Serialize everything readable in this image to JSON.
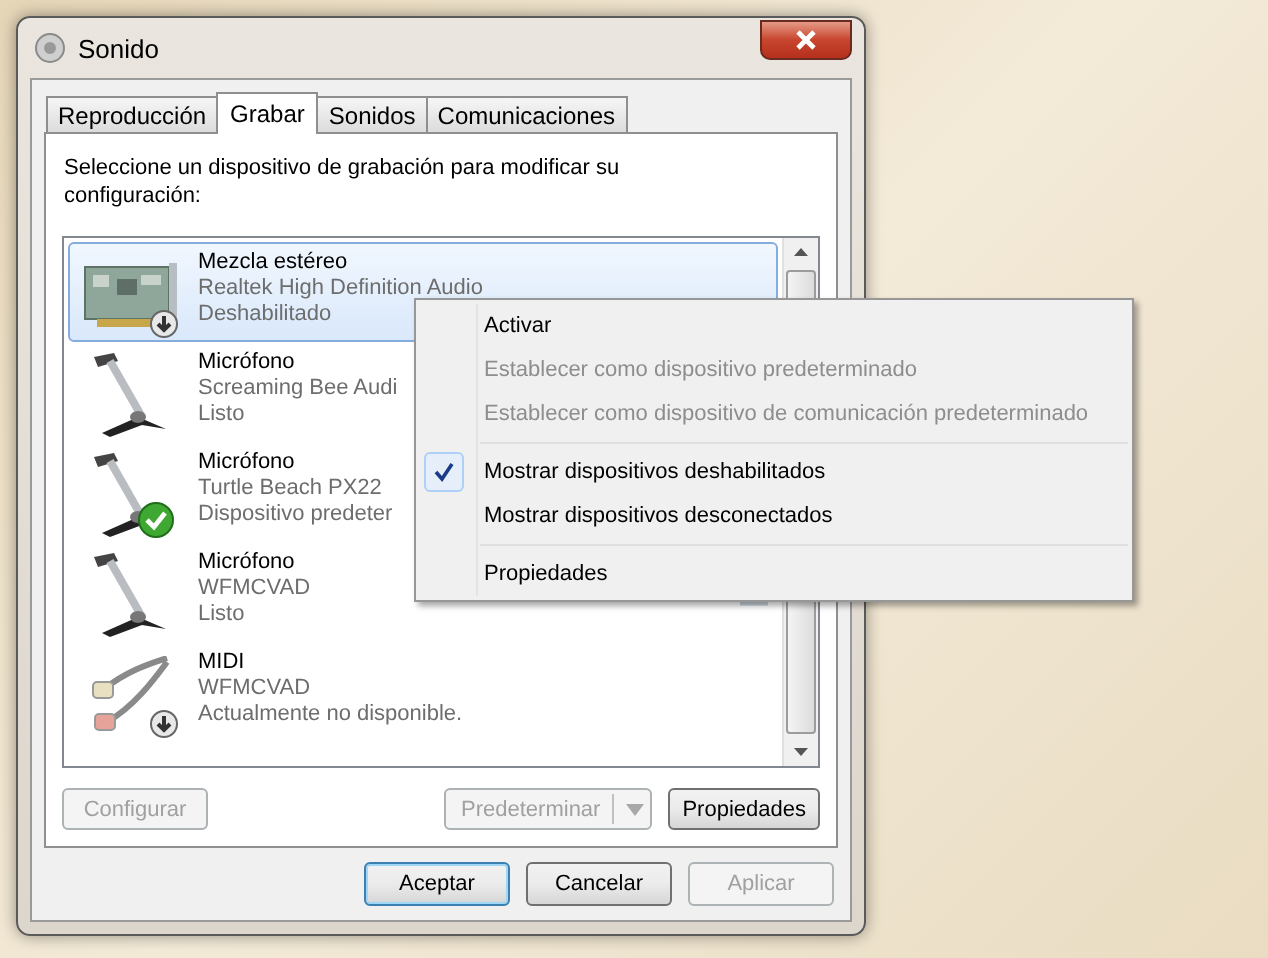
{
  "window": {
    "title": "Sonido"
  },
  "tabs": [
    {
      "label": "Reproducción",
      "selected": false
    },
    {
      "label": "Grabar",
      "selected": true
    },
    {
      "label": "Sonidos",
      "selected": false
    },
    {
      "label": "Comunicaciones",
      "selected": false
    }
  ],
  "instructions": "Seleccione un dispositivo de grabación para modificar su configuración:",
  "devices": [
    {
      "kind": "card",
      "name": "Mezcla estéreo",
      "driver": "Realtek High Definition Audio",
      "status": "Deshabilitado",
      "down_arrow": true,
      "default": false,
      "selected": true,
      "meter": false
    },
    {
      "kind": "mic",
      "name": "Micrófono",
      "driver": "Screaming Bee Audi",
      "status": "Listo",
      "down_arrow": false,
      "default": false,
      "selected": false,
      "meter": false
    },
    {
      "kind": "mic",
      "name": "Micrófono",
      "driver": "Turtle Beach PX22",
      "status": "Dispositivo predeter",
      "down_arrow": false,
      "default": true,
      "selected": false,
      "meter": false
    },
    {
      "kind": "mic",
      "name": "Micrófono",
      "driver": "WFMCVAD",
      "status": "Listo",
      "down_arrow": false,
      "default": false,
      "selected": false,
      "meter": true
    },
    {
      "kind": "cable",
      "name": "MIDI",
      "driver": "WFMCVAD",
      "status": "Actualmente no disponible.",
      "down_arrow": true,
      "default": false,
      "selected": false,
      "meter": false
    }
  ],
  "panel_buttons": [
    {
      "label": "Configurar",
      "disabled": true,
      "kind": "plain"
    },
    {
      "label": "Predeterminar",
      "disabled": true,
      "kind": "split"
    },
    {
      "label": "Propiedades",
      "disabled": false,
      "kind": "plain"
    }
  ],
  "dialog_buttons": [
    {
      "label": "Aceptar",
      "disabled": false,
      "default": true
    },
    {
      "label": "Cancelar",
      "disabled": false,
      "default": false
    },
    {
      "label": "Aplicar",
      "disabled": true,
      "default": false
    }
  ],
  "context_menu": [
    {
      "kind": "item",
      "label": "Activar",
      "disabled": false,
      "checked": false
    },
    {
      "kind": "item",
      "label": "Establecer como dispositivo predeterminado",
      "disabled": true,
      "checked": false
    },
    {
      "kind": "item",
      "label": "Establecer como dispositivo de comunicación predeterminado",
      "disabled": true,
      "checked": false
    },
    {
      "kind": "separator"
    },
    {
      "kind": "item",
      "label": "Mostrar dispositivos deshabilitados",
      "disabled": false,
      "checked": true
    },
    {
      "kind": "item",
      "label": "Mostrar dispositivos desconectados",
      "disabled": false,
      "checked": false
    },
    {
      "kind": "separator"
    },
    {
      "kind": "item",
      "label": "Propiedades",
      "disabled": false,
      "checked": false
    }
  ]
}
